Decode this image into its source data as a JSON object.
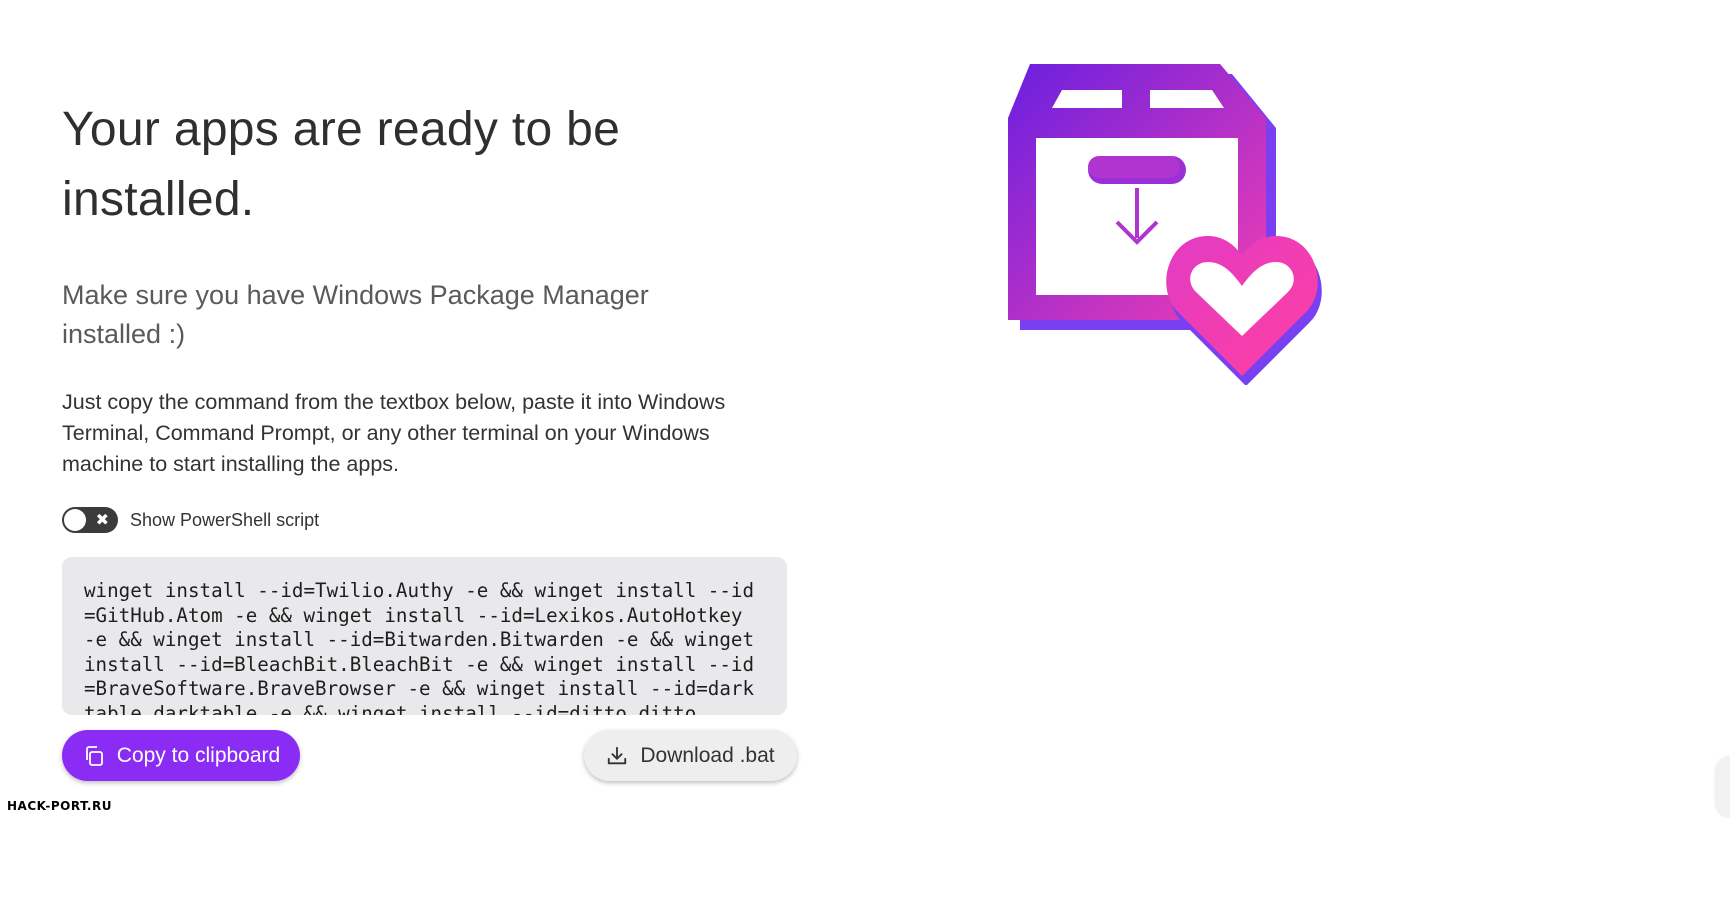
{
  "header": {
    "title": "Your apps are ready to be installed.",
    "subtitle": "Make sure you have Windows Package Manager installed :)",
    "instructions": "Just copy the command from the textbox below, paste it into Windows Terminal, Command Prompt, or any other terminal on your Windows machine to start installing the apps."
  },
  "toggle": {
    "label": "Show PowerShell script",
    "state": "off",
    "off_glyph": "✖"
  },
  "command_box": {
    "text": "winget install --id=Twilio.Authy -e && winget install --id=GitHub.Atom -e && winget install --id=Lexikos.AutoHotkey -e && winget install --id=Bitwarden.Bitwarden -e && winget install --id=BleachBit.BleachBit -e && winget install --id=BraveSoftware.BraveBrowser -e && winget install --id=darktable.darktable -e && winget install --id=ditto.ditto"
  },
  "actions": {
    "copy_label": "Copy to clipboard",
    "copy_icon": "copy-icon",
    "download_label": "Download .bat",
    "download_icon": "download-icon"
  },
  "illustration": {
    "icon": "package-heart-icon"
  },
  "watermark": "HACK-PORT.RU",
  "colors": {
    "accent": "#8b2cf5",
    "gradient_start": "#6a1fe0",
    "gradient_end": "#f23fb2",
    "code_background": "#e9e9ec"
  }
}
